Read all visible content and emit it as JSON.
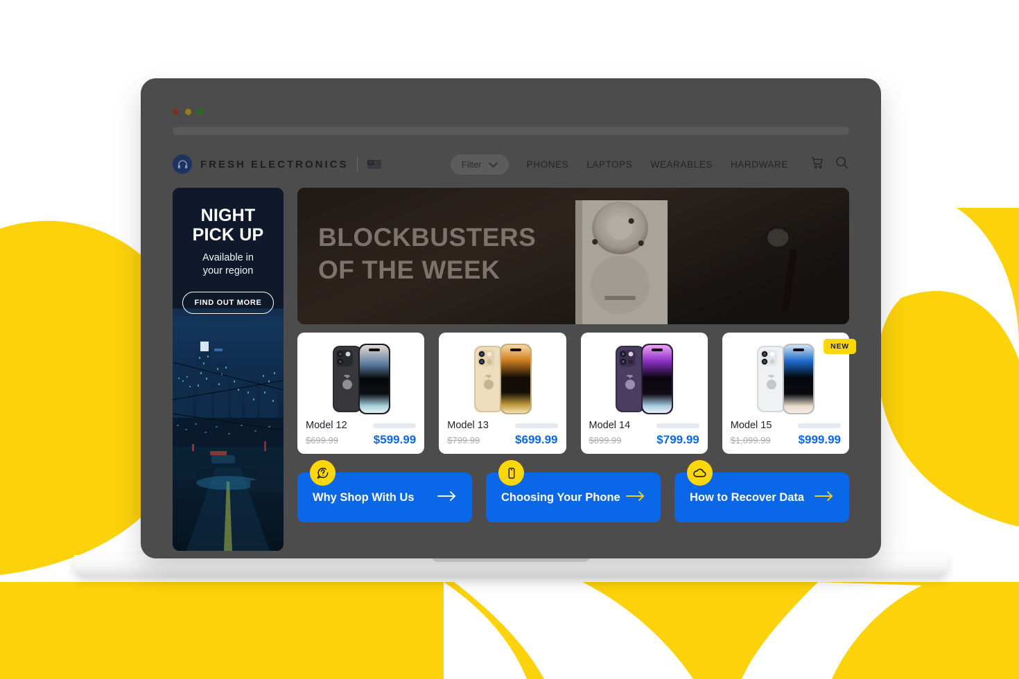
{
  "window": {
    "traffic_lights": [
      "close",
      "minimize",
      "maximize"
    ]
  },
  "header": {
    "logo_icon": "headphones-icon",
    "brand": "FRESH ELECTRONICS",
    "flag_icon": "us-flag-icon",
    "filter": {
      "label": "Filter",
      "chevron_icon": "chevron-down-icon"
    },
    "nav": [
      "PHONES",
      "LAPTOPS",
      "WEARABLES",
      "HARDWARE"
    ],
    "cart_icon": "cart-icon",
    "search_icon": "search-icon"
  },
  "promo": {
    "title_line1": "NIGHT",
    "title_line2": "PICK UP",
    "subtitle_line1": "Available in",
    "subtitle_line2": "your region",
    "button": "FIND OUT MORE"
  },
  "hero": {
    "line1": "BLOCKBUSTERS",
    "line2": "OF THE WEEK"
  },
  "products": [
    {
      "name": "Model 12",
      "old_price": "$699.99",
      "new_price": "$599.99",
      "badge": "",
      "finish": "space-black"
    },
    {
      "name": "Model 13",
      "old_price": "$799.99",
      "new_price": "$699.99",
      "badge": "",
      "finish": "gold"
    },
    {
      "name": "Model 14",
      "old_price": "$899.99",
      "new_price": "$799.99",
      "badge": "",
      "finish": "deep-purple"
    },
    {
      "name": "Model 15",
      "old_price": "$1,099.99",
      "new_price": "$999.99",
      "badge": "NEW",
      "finish": "silver"
    }
  ],
  "ctas": [
    {
      "label": "Why Shop With Us",
      "icon": "question-bubble-icon",
      "arrow_icon": "arrow-right-icon",
      "arrow_color": "#ffffff"
    },
    {
      "label": "Choosing Your Phone",
      "icon": "phone-icon",
      "arrow_icon": "arrow-right-icon",
      "arrow_color": "#f2d218"
    },
    {
      "label": "How to Recover Data",
      "icon": "cloud-icon",
      "arrow_icon": "arrow-right-icon",
      "arrow_color": "#f2d218"
    }
  ],
  "colors": {
    "accent_yellow": "#fcd80b",
    "accent_blue": "#0a68e8",
    "brand_navy": "#1d3461",
    "laptop_body": "#4c4c4c"
  }
}
